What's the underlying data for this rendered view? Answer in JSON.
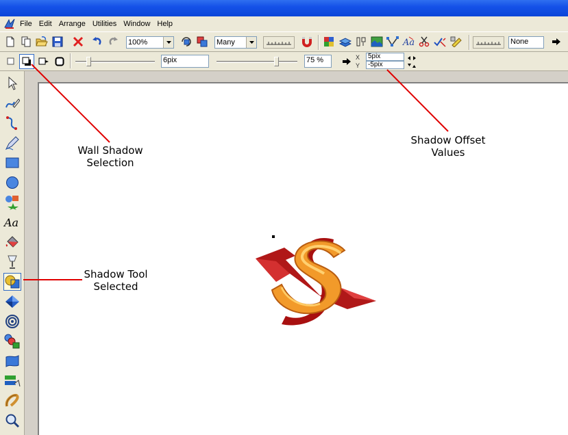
{
  "menu": {
    "items": [
      "File",
      "Edit",
      "Arrange",
      "Utilities",
      "Window",
      "Help"
    ]
  },
  "toolbar": {
    "zoom_value": "100%",
    "many_value": "Many",
    "none_value": "None"
  },
  "shadow_bar": {
    "softness_value": "6pix",
    "opacity_value": "75 %",
    "offset_x_label": "X",
    "offset_y_label": "Y",
    "offset_x_value": "5pix",
    "offset_y_value": "-5pix"
  },
  "annotations": {
    "wall_shadow_line1": "Wall Shadow",
    "wall_shadow_line2": "Selection",
    "shadow_offset_line1": "Shadow Offset",
    "shadow_offset_line2": "Values",
    "shadow_tool_line1": "Shadow Tool",
    "shadow_tool_line2": "Selected"
  },
  "colors": {
    "title_blue": "#0a45d8",
    "annotation_red": "#e00000",
    "selection_blue": "#316ac5"
  }
}
